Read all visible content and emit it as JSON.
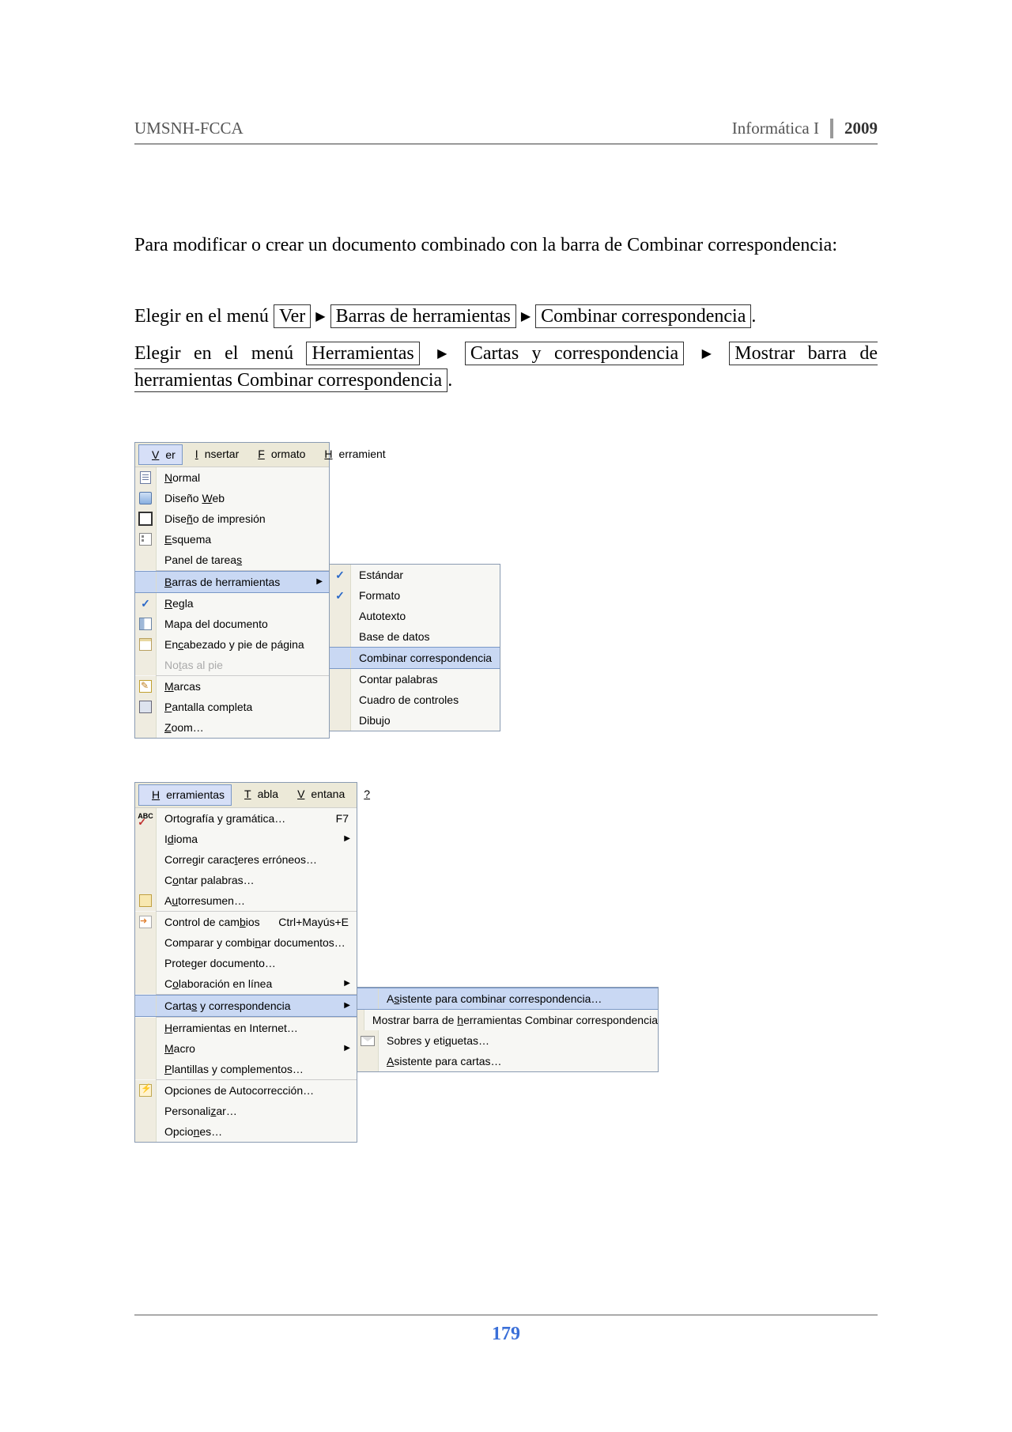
{
  "header": {
    "left": "UMSNH-FCCA",
    "course": "Informática I",
    "year": "2009"
  },
  "intro": "Para modificar o crear un documento combinado con la barra de Combinar correspondencia:",
  "step1": {
    "lead": "Elegir en el menú",
    "b1": "Ver",
    "b2": "Barras de herramientas",
    "b3": "Combinar correspondencia",
    "tail": "."
  },
  "step2": {
    "lead": "Elegir  en  el  menú",
    "b1": "Herramientas",
    "b2": "Cartas  y  correspondencia",
    "b3": "Mostrar  barra  de herramientas Combinar correspondencia",
    "tail": "."
  },
  "vermenu": {
    "bar": [
      "Ver",
      "Insertar",
      "Formato",
      "Herramient"
    ],
    "items": [
      {
        "icon": "page",
        "label": "Normal",
        "u": "N"
      },
      {
        "icon": "web",
        "label": "Diseño Web",
        "u": "W"
      },
      {
        "icon": "print",
        "label": "Diseño de impresión",
        "u": "ñ",
        "sel": false
      },
      {
        "icon": "outline",
        "label": "Esquema",
        "u": "E"
      },
      {
        "icon": "",
        "label": "Panel de tareas",
        "u": "s",
        "sep": true
      },
      {
        "icon": "",
        "label": "Barras de herramientas",
        "u": "B",
        "arrow": true,
        "sel": true
      },
      {
        "icon": "check",
        "label": "Regla",
        "u": "R"
      },
      {
        "icon": "docmap",
        "label": "Mapa del documento",
        "u": ""
      },
      {
        "icon": "hdr",
        "label": "Encabezado y pie de página",
        "u": "c"
      },
      {
        "icon": "",
        "label": "Notas al pie",
        "u": "t",
        "dis": true,
        "sep": true
      },
      {
        "icon": "marks",
        "label": "Marcas",
        "u": "M"
      },
      {
        "icon": "full",
        "label": "Pantalla completa",
        "u": "P"
      },
      {
        "icon": "",
        "label": "Zoom…",
        "u": "Z"
      }
    ],
    "sub": [
      {
        "check": true,
        "label": "Estándar"
      },
      {
        "check": true,
        "label": "Formato"
      },
      {
        "check": false,
        "label": "Autotexto"
      },
      {
        "check": false,
        "label": "Base de datos"
      },
      {
        "check": false,
        "label": "Combinar correspondencia",
        "sel": true
      },
      {
        "check": false,
        "label": "Contar palabras"
      },
      {
        "check": false,
        "label": "Cuadro de controles"
      },
      {
        "check": false,
        "label": "Dibujo"
      }
    ]
  },
  "herrmenu": {
    "bar": [
      "Herramientas",
      "Tabla",
      "Ventana",
      "?"
    ],
    "items": [
      {
        "icon": "spell",
        "label": "Ortografía y gramática…",
        "sc": "F7"
      },
      {
        "icon": "",
        "label": "Idioma",
        "u": "d",
        "arrow": true
      },
      {
        "icon": "",
        "label": "Corregir caracteres erróneos…",
        "u": "t"
      },
      {
        "icon": "",
        "label": "Contar palabras…",
        "u": "o"
      },
      {
        "icon": "sum",
        "label": "Autorresumen…",
        "u": "u",
        "sep": true
      },
      {
        "icon": "track",
        "label": "Control de cambios",
        "u": "b",
        "sc": "Ctrl+Mayús+E"
      },
      {
        "icon": "",
        "label": "Comparar y combinar documentos…",
        "u": "n"
      },
      {
        "icon": "",
        "label": "Proteger documento…",
        "u": ""
      },
      {
        "icon": "",
        "label": "Colaboración en línea",
        "u": "o",
        "arrow": true,
        "sep": true
      },
      {
        "icon": "",
        "label": "Cartas y correspondencia",
        "u": "s",
        "arrow": true,
        "sel": true,
        "sep": true
      },
      {
        "icon": "",
        "label": "Herramientas en Internet…",
        "u": "h"
      },
      {
        "icon": "",
        "label": "Macro",
        "u": "M",
        "arrow": true
      },
      {
        "icon": "",
        "label": "Plantillas y complementos…",
        "u": "P",
        "sep": true
      },
      {
        "icon": "auto",
        "label": "Opciones de Autocorrección…",
        "u": ""
      },
      {
        "icon": "",
        "label": "Personalizar…",
        "u": "z"
      },
      {
        "icon": "",
        "label": "Opciones…",
        "u": "n"
      }
    ],
    "sub": [
      {
        "icon": "",
        "label": "Asistente para combinar correspondencia…",
        "u": "s",
        "sel": true
      },
      {
        "icon": "",
        "label": "Mostrar barra de herramientas Combinar correspondencia",
        "u": "h"
      },
      {
        "icon": "env",
        "label": "Sobres y etiquetas…",
        "u": "q"
      },
      {
        "icon": "",
        "label": "Asistente para cartas…",
        "u": "A"
      }
    ]
  },
  "pagenum": "179"
}
